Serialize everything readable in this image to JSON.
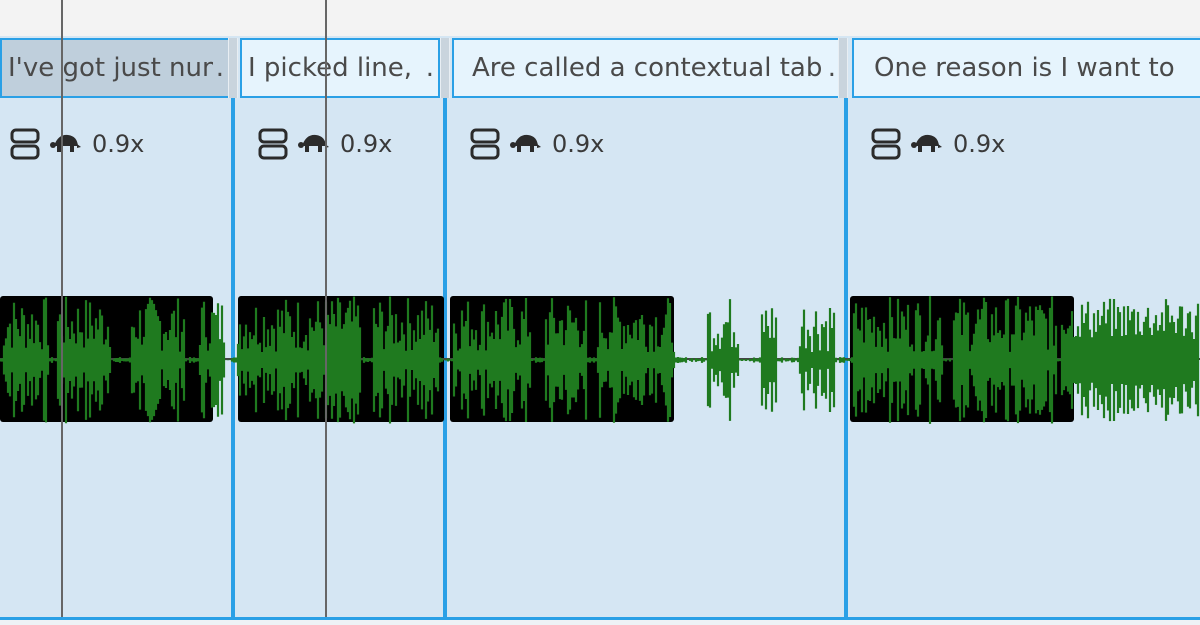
{
  "labels": [
    {
      "text": "I've got just num",
      "selected": true
    },
    {
      "text": "I picked line,",
      "selected": false
    },
    {
      "text": "Are called a contextual tab",
      "selected": false
    },
    {
      "text": "One reason is I want to",
      "selected": false
    }
  ],
  "ellipsis": ".",
  "clips": [
    {
      "speed": "0.9x",
      "stretch_icon": "stretch-icon",
      "speed_icon": "turtle-icon"
    },
    {
      "speed": "0.9x",
      "stretch_icon": "stretch-icon",
      "speed_icon": "turtle-icon"
    },
    {
      "speed": "0.9x",
      "stretch_icon": "stretch-icon",
      "speed_icon": "turtle-icon"
    },
    {
      "speed": "0.9x",
      "stretch_icon": "stretch-icon",
      "speed_icon": "turtle-icon"
    }
  ],
  "colors": {
    "waveform": "#1f7a1f",
    "selection_bg": "#000000",
    "accent": "#2aa0e6",
    "track_bg": "#d5e6f3"
  }
}
